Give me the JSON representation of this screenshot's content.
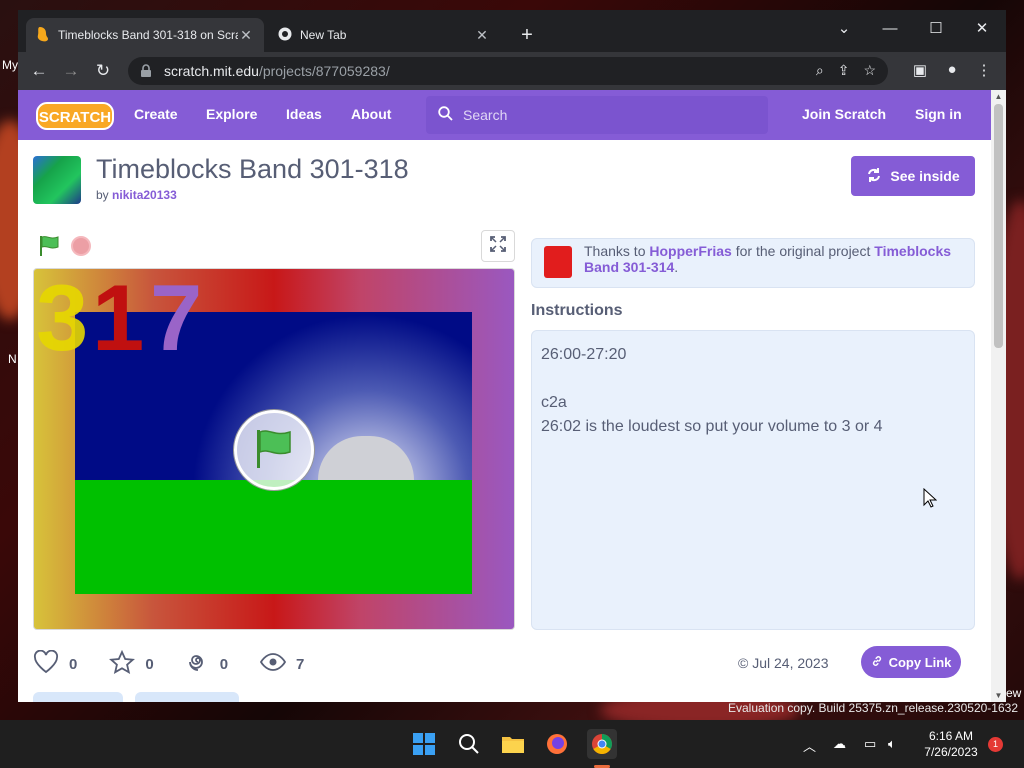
{
  "desktop": {
    "label_my": "My",
    "label_n": "N",
    "label_ew": "ew",
    "evaluation_text": "Evaluation copy. Build 25375.zn_release.230520-1632"
  },
  "browser": {
    "tabs": [
      {
        "title": "Timeblocks Band 301-318 on Scratch",
        "active": true,
        "icon": "scratch-favicon"
      },
      {
        "title": "New Tab",
        "active": false,
        "icon": "chrome-icon"
      }
    ],
    "url_host": "scratch.mit.edu",
    "url_path": "/projects/877059283/"
  },
  "nav": {
    "logo": "SCRATCH",
    "links": [
      "Create",
      "Explore",
      "Ideas",
      "About"
    ],
    "search_placeholder": "Search",
    "join": "Join Scratch",
    "signin": "Sign in"
  },
  "project": {
    "title": "Timeblocks Band 301-318",
    "by_label": "by",
    "author": "nikita20133",
    "see_inside": "See inside",
    "stage_digits": [
      "3",
      "1",
      "7"
    ],
    "credit": {
      "prefix": "Thanks to",
      "user": "HopperFrias",
      "middle": "for the original project",
      "project": "Timeblocks Band 301-314",
      "suffix": "."
    },
    "instructions_heading": "Instructions",
    "instructions_lines": [
      "26:00-27:20",
      "",
      "c2a",
      "26:02 is the loudest so put your volume to 3 or 4"
    ],
    "stats": {
      "loves": "0",
      "favorites": "0",
      "remixes": "0",
      "views": "7"
    },
    "date": "Jul 24, 2023",
    "copy_link": "Copy Link"
  },
  "taskbar": {
    "time": "6:16 AM",
    "date": "7/26/2023",
    "notification_count": "1"
  },
  "colors": {
    "scratch_purple": "#855cd6",
    "chrome_dark": "#202124",
    "chrome_toolbar": "#35363a"
  }
}
